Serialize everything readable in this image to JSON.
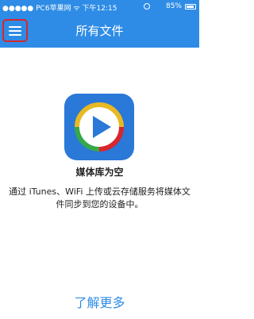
{
  "status_bar": {
    "carrier": "●●●●● PC6苹果网 ᯤ",
    "time": "下午12:15",
    "battery": "85%"
  },
  "nav": {
    "title": "所有文件"
  },
  "empty_state": {
    "icon": "play-icon",
    "title": "媒体库为空",
    "description": "通过 iTunes、WiFi 上传或云存储服务将媒体文件同步到您的设备中。"
  },
  "learn_more": "了解更多",
  "colors": {
    "accent": "#2e8ce6",
    "highlight": "#d8262c"
  }
}
